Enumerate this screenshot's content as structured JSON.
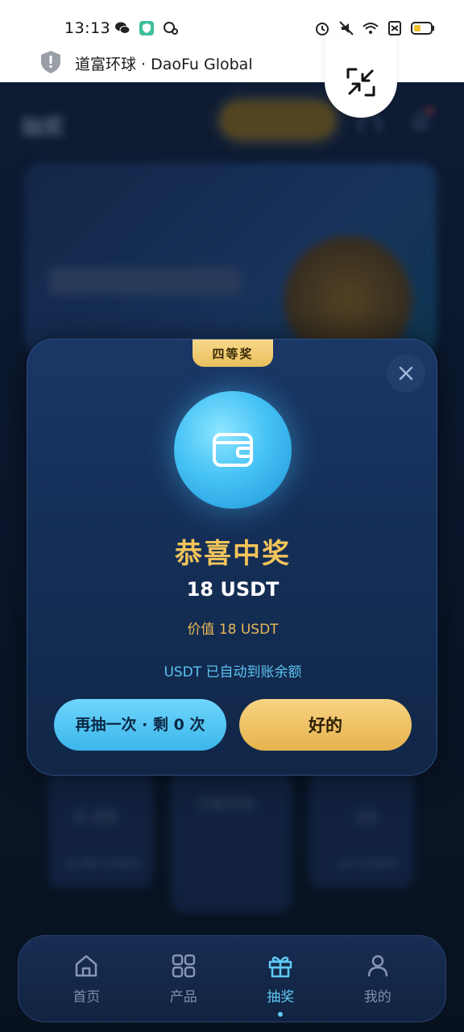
{
  "status_bar": {
    "time": "13:13",
    "left_icons": [
      "wechat-icon",
      "app-shield-icon",
      "qq-icon"
    ],
    "right_icons": [
      "alarm-icon",
      "mute-icon",
      "wifi-icon",
      "sim-off-icon",
      "battery-icon"
    ]
  },
  "browser": {
    "site_title": "道富环球 · DaoFu Global",
    "minimize_icon": "exit-fullscreen-icon"
  },
  "background_page": {
    "title": "抽奖",
    "card_values": [
      "0.88",
      "18"
    ],
    "card_units": [
      "0.88 USDT",
      "18 USDT"
    ],
    "middle_card_label": "次数用完"
  },
  "modal": {
    "tier": "四等奖",
    "title": "恭喜中奖",
    "amount": "18 USDT",
    "value_text": "价值 18 USDT",
    "note": "USDT 已自动到账余额",
    "again_button": "再抽一次 · 剩 0 次",
    "ok_button": "好的",
    "colors": {
      "gold": "#f2c45a",
      "cyan": "#5cc3f1",
      "panel": "#15305a"
    }
  },
  "tabbar": {
    "items": [
      {
        "label": "首页",
        "icon": "home-icon",
        "active": false
      },
      {
        "label": "产品",
        "icon": "grid-icon",
        "active": false
      },
      {
        "label": "抽奖",
        "icon": "gift-icon",
        "active": true
      },
      {
        "label": "我的",
        "icon": "user-icon",
        "active": false
      }
    ]
  }
}
